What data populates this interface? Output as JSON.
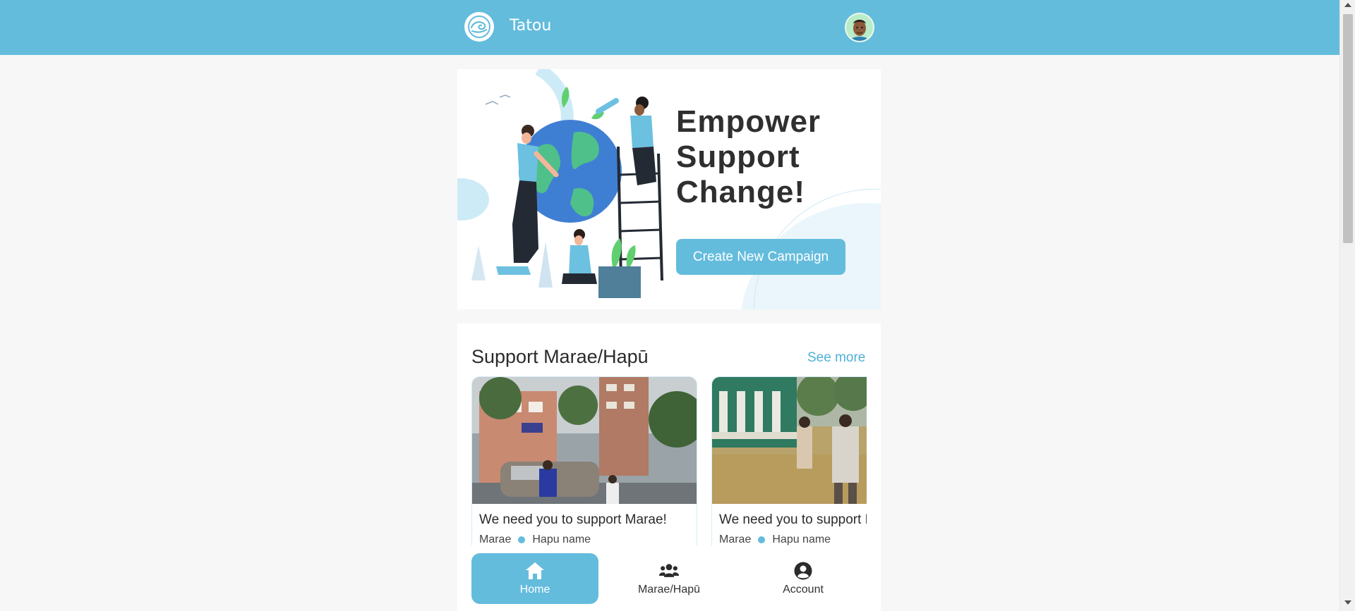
{
  "app": {
    "title": "Tatou"
  },
  "hero": {
    "headline_1": "Empower",
    "headline_2": "Support",
    "headline_3": "Change!",
    "cta_label": "Create New Campaign"
  },
  "section": {
    "title": "Support Marae/Hapū",
    "see_more": "See more",
    "cards": [
      {
        "title": "We need you to support Marae!",
        "type": "Marae",
        "hapu": "Hapu name"
      },
      {
        "title": "We need you to support Marae!",
        "type": "Marae",
        "hapu": "Hapu name"
      }
    ]
  },
  "nav": {
    "items": [
      {
        "label": "Home",
        "icon": "home-icon",
        "active": true
      },
      {
        "label": "Marae/Hapū",
        "icon": "users-icon",
        "active": false
      },
      {
        "label": "Account",
        "icon": "user-circle-icon",
        "active": false
      }
    ]
  },
  "colors": {
    "accent": "#64bcdd",
    "background": "#f7f7f7",
    "surface": "#ffffff"
  }
}
